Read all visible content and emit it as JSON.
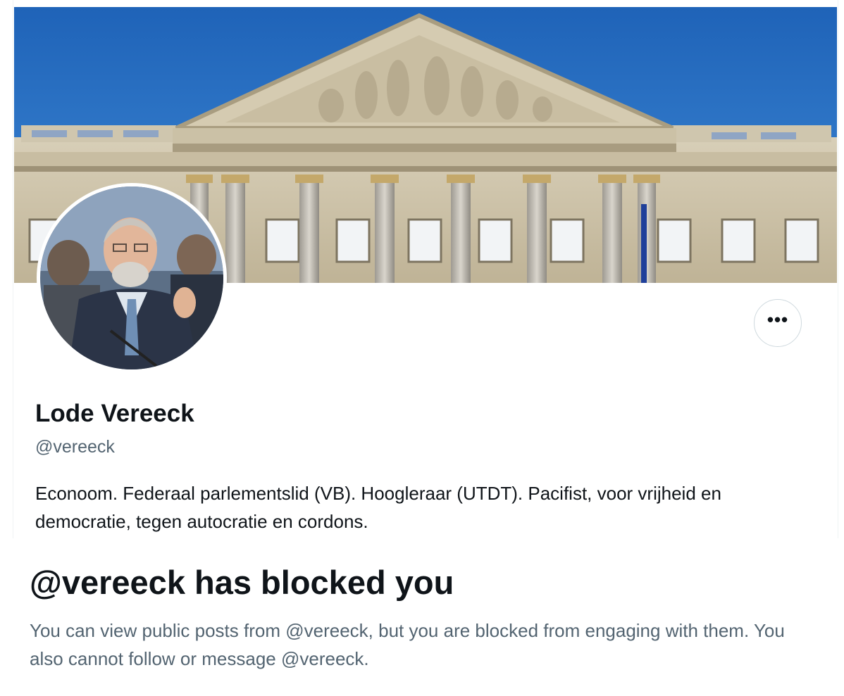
{
  "profile": {
    "display_name": "Lode Vereeck",
    "handle": "@vereeck",
    "bio": "Econoom. Federaal parlementslid (VB). Hoogleraar (UTDT). Pacifist, voor vrijheid en democratie, tegen autocratie en cordons.",
    "more_button_label": "•••",
    "banner_icon": "building-photo",
    "avatar_icon": "profile-photo"
  },
  "blocked_notice": {
    "title": "@vereeck has blocked you",
    "message": "You can view public posts from @vereeck, but you are blocked from engaging with them. You also cannot follow or message @vereeck."
  },
  "colors": {
    "text_primary": "#0f1419",
    "text_secondary": "#536471",
    "border": "#cfd9de",
    "sky": "#2f74c8"
  }
}
